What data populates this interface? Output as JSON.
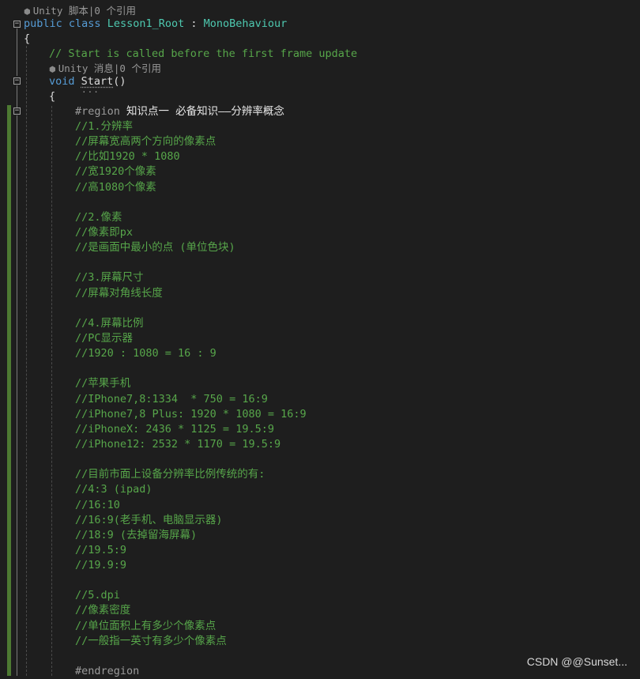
{
  "codelens": {
    "script_refs": "Unity 脚本|0 个引用",
    "message_refs": "Unity 消息|0 个引用"
  },
  "code": {
    "kw_public": "public",
    "kw_class": "class",
    "class_name": "Lesson1_Root",
    "colon": " : ",
    "base_class": "MonoBehaviour",
    "brace_open": "{",
    "comment_start": "// Start is called before the first frame update",
    "kw_void": "void",
    "method_name": "Start",
    "parens": "()",
    "method_brace": "{",
    "region_directive": "#region",
    "region_name": "知识点一 必备知识——分辨率概念",
    "endregion_directive": "#endregion",
    "lines": [
      "//1.分辨率",
      "//屏幕宽高两个方向的像素点",
      "//比如1920 * 1080",
      "//宽1920个像素",
      "//高1080个像素",
      "",
      "//2.像素",
      "//像素即px",
      "//是画面中最小的点 (单位色块)",
      "",
      "//3.屏幕尺寸",
      "//屏幕对角线长度",
      "",
      "//4.屏幕比例",
      "//PC显示器",
      "//1920 : 1080 = 16 : 9",
      "",
      "//苹果手机",
      "//IPhone7,8:1334  * 750 = 16:9",
      "//iPhone7,8 Plus: 1920 * 1080 = 16:9",
      "//iPhoneX: 2436 * 1125 = 19.5:9",
      "//iPhone12: 2532 * 1170 = 19.5:9",
      "",
      "//目前市面上设备分辨率比例传统的有:",
      "//4:3 (ipad)",
      "//16:10",
      "//16:9(老手机、电脑显示器)",
      "//18:9 (去掉留海屏幕)",
      "//19.5:9",
      "//19.9:9",
      "",
      "//5.dpi",
      "//像素密度",
      "//单位面积上有多少个像素点",
      "//一般指一英寸有多少个像素点"
    ]
  },
  "watermark": "CSDN @@Sunset...",
  "colors": {
    "background": "#1e1e1e",
    "keyword": "#569cd6",
    "type": "#4ec9b0",
    "comment": "#57a64a",
    "change_bar": "#4d7a32"
  }
}
